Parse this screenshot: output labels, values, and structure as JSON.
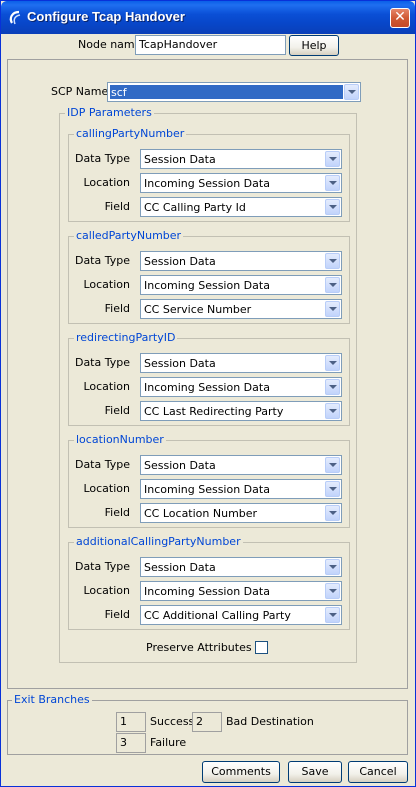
{
  "window": {
    "title": "Configure Tcap Handover",
    "close_glyph": "✕"
  },
  "node": {
    "label": "Node name",
    "value": "TcapHandover",
    "help_label": "Help"
  },
  "scp": {
    "label": "SCP Name",
    "value": "scf"
  },
  "idp": {
    "legend": "IDP Parameters"
  },
  "field_labels": {
    "data_type": "Data Type",
    "location": "Location",
    "field": "Field"
  },
  "groups": [
    {
      "legend": "callingPartyNumber",
      "data_type": "Session Data",
      "location": "Incoming Session Data",
      "field": "CC Calling Party Id"
    },
    {
      "legend": "calledPartyNumber",
      "data_type": "Session Data",
      "location": "Incoming Session Data",
      "field": "CC Service Number"
    },
    {
      "legend": "redirectingPartyID",
      "data_type": "Session Data",
      "location": "Incoming Session Data",
      "field": "CC Last Redirecting Party"
    },
    {
      "legend": "locationNumber",
      "data_type": "Session Data",
      "location": "Incoming Session Data",
      "field": "CC Location Number"
    },
    {
      "legend": "additionalCallingPartyNumber",
      "data_type": "Session Data",
      "location": "Incoming Session Data",
      "field": "CC Additional Calling Party"
    }
  ],
  "preserve": {
    "label": "Preserve Attributes"
  },
  "exit": {
    "legend": "Exit Branches",
    "branches": [
      {
        "num": "1",
        "label": "Success"
      },
      {
        "num": "2",
        "label": "Bad Destination"
      },
      {
        "num": "3",
        "label": "Failure"
      }
    ]
  },
  "buttons": {
    "comments": "Comments",
    "save": "Save",
    "cancel": "Cancel"
  }
}
